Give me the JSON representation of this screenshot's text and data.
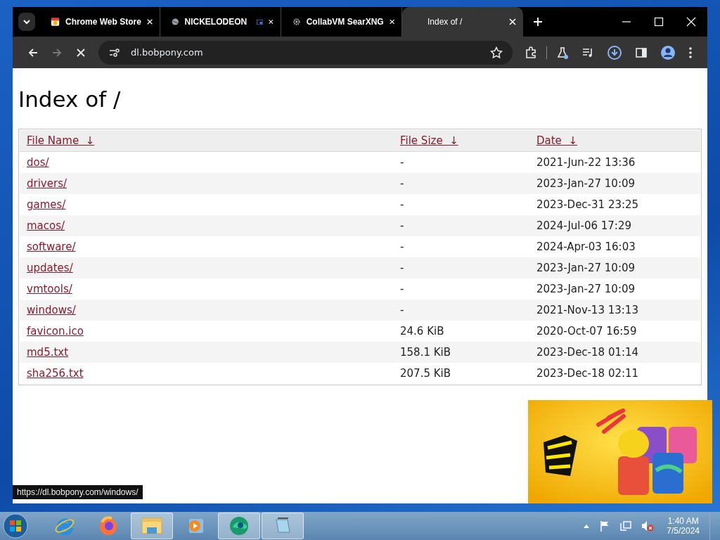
{
  "browser": {
    "loading": true,
    "tabs": [
      {
        "title": "Chrome Web Store",
        "kind": "store",
        "selected": false,
        "pip": false
      },
      {
        "title": "NICKELODEON",
        "kind": "globe",
        "selected": false,
        "pip": true
      },
      {
        "title": "CollabVM SearXNG",
        "kind": "gear",
        "selected": false,
        "pip": false
      },
      {
        "title": "Index of /",
        "selected": true,
        "pip": false
      }
    ],
    "address": "dl.bobpony.com"
  },
  "page": {
    "heading": "Index of /",
    "columns": [
      {
        "label": "File Name",
        "sort": "↓"
      },
      {
        "label": "File Size",
        "sort": "↓"
      },
      {
        "label": "Date",
        "sort": "↓"
      }
    ],
    "rows": [
      {
        "name": "dos/",
        "size": "-",
        "date": "2021-Jun-22 13:36"
      },
      {
        "name": "drivers/",
        "size": "-",
        "date": "2023-Jan-27 10:09"
      },
      {
        "name": "games/",
        "size": "-",
        "date": "2023-Dec-31 23:25"
      },
      {
        "name": "macos/",
        "size": "-",
        "date": "2024-Jul-06 17:29"
      },
      {
        "name": "software/",
        "size": "-",
        "date": "2024-Apr-03 16:03"
      },
      {
        "name": "updates/",
        "size": "-",
        "date": "2023-Jan-27 10:09"
      },
      {
        "name": "vmtools/",
        "size": "-",
        "date": "2023-Jan-27 10:09"
      },
      {
        "name": "windows/",
        "size": "-",
        "date": "2021-Nov-13 13:13"
      },
      {
        "name": "favicon.ico",
        "size": "24.6 KiB",
        "date": "2020-Oct-07 16:59"
      },
      {
        "name": "md5.txt",
        "size": "158.1 KiB",
        "date": "2023-Dec-18 01:14"
      },
      {
        "name": "sha256.txt",
        "size": "207.5 KiB",
        "date": "2023-Dec-18 02:11"
      }
    ],
    "status_url": "https://dl.bobpony.com/windows/"
  },
  "taskbar": {
    "apps": [
      {
        "kind": "ie",
        "open": false
      },
      {
        "kind": "firefox",
        "open": false
      },
      {
        "kind": "explorer",
        "open": true
      },
      {
        "kind": "media",
        "open": false
      },
      {
        "kind": "edge",
        "open": true
      },
      {
        "kind": "notepad",
        "open": true
      }
    ],
    "volume_muted": true,
    "time": "1:40 AM",
    "date": "7/5/2024"
  }
}
